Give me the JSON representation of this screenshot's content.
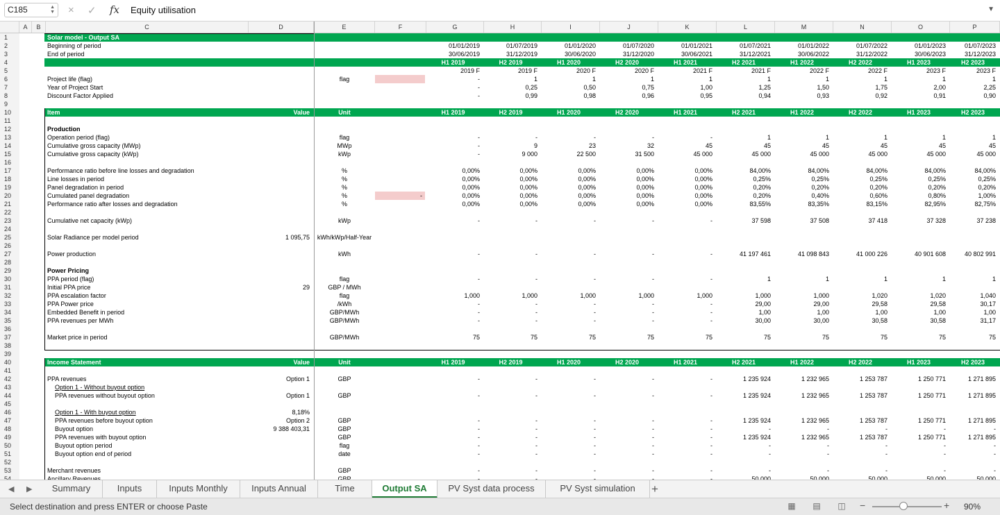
{
  "formula_bar": {
    "name_box": "C185",
    "cancel_icon": "×",
    "enter_icon": "✓",
    "fx_label": "fx",
    "formula": "Equity utilisation"
  },
  "columns": [
    "A",
    "B",
    "C",
    "D",
    "E",
    "F",
    "G",
    "H",
    "I",
    "J",
    "K",
    "L",
    "M",
    "N",
    "O",
    "P"
  ],
  "rows": [
    {
      "n": "1",
      "cls": "hdr",
      "cells": {
        "C": "Solar model - Output SA"
      }
    },
    {
      "n": "2",
      "cells": {
        "C": "Beginning of period",
        "G": "01/01/2019",
        "H": "01/07/2019",
        "I": "01/01/2020",
        "J": "01/07/2020",
        "K": "01/01/2021",
        "L": "01/07/2021",
        "M": "01/01/2022",
        "N": "01/07/2022",
        "O": "01/01/2023",
        "P": "01/07/2023"
      }
    },
    {
      "n": "3",
      "cells": {
        "C": "End of period",
        "G": "30/06/2019",
        "H": "31/12/2019",
        "I": "30/06/2020",
        "J": "31/12/2020",
        "K": "30/06/2021",
        "L": "31/12/2021",
        "M": "30/06/2022",
        "N": "31/12/2022",
        "O": "30/06/2023",
        "P": "31/12/2023"
      }
    },
    {
      "n": "4",
      "cls": "hdr",
      "cells": {
        "G": "H1 2019",
        "H": "H2 2019",
        "I": "H1 2020",
        "J": "H2 2020",
        "K": "H1 2021",
        "L": "H2 2021",
        "M": "H1 2022",
        "N": "H2 2022",
        "O": "H1 2023",
        "P": "H2 2023"
      }
    },
    {
      "n": "5",
      "cells": {
        "G": "2019 F",
        "H": "2019 F",
        "I": "2020 F",
        "J": "2020 F",
        "K": "2021 F",
        "L": "2021 F",
        "M": "2022 F",
        "N": "2022 F",
        "O": "2023 F",
        "P": "2023 F"
      }
    },
    {
      "n": "6",
      "pink": true,
      "cells": {
        "C": "Project life (flag)",
        "E": "flag",
        "G": "-",
        "H": "1",
        "I": "1",
        "J": "1",
        "K": "1",
        "L": "1",
        "M": "1",
        "N": "1",
        "O": "1",
        "P": "1"
      }
    },
    {
      "n": "7",
      "cells": {
        "C": "Year of Project Start",
        "G": "-",
        "H": "0,25",
        "I": "0,50",
        "J": "0,75",
        "K": "1,00",
        "L": "1,25",
        "M": "1,50",
        "N": "1,75",
        "O": "2,00",
        "P": "2,25"
      }
    },
    {
      "n": "8",
      "cells": {
        "C": "Discount Factor Applied",
        "G": "-",
        "H": "0,99",
        "I": "0,98",
        "J": "0,96",
        "K": "0,95",
        "L": "0,94",
        "M": "0,93",
        "N": "0,92",
        "O": "0,91",
        "P": "0,90"
      }
    },
    {
      "n": "9",
      "cells": {}
    },
    {
      "n": "10",
      "cls": "hdr",
      "cells": {
        "C": "Item",
        "D": "Value",
        "E": "Unit",
        "G": "H1 2019",
        "H": "H2 2019",
        "I": "H1 2020",
        "J": "H2 2020",
        "K": "H1 2021",
        "L": "H2 2021",
        "M": "H1 2022",
        "N": "H2 2022",
        "O": "H1 2023",
        "P": "H2 2023"
      }
    },
    {
      "n": "11",
      "cells": {}
    },
    {
      "n": "12",
      "bold": true,
      "cells": {
        "C": "Production"
      }
    },
    {
      "n": "13",
      "cells": {
        "C": "Operation period (flag)",
        "E": "flag",
        "G": "-",
        "H": "-",
        "I": "-",
        "J": "-",
        "K": "-",
        "L": "1",
        "M": "1",
        "N": "1",
        "O": "1",
        "P": "1"
      }
    },
    {
      "n": "14",
      "cells": {
        "C": "Cumulative gross capacity (MWp)",
        "E": "MWp",
        "G": "-",
        "H": "9",
        "I": "23",
        "J": "32",
        "K": "45",
        "L": "45",
        "M": "45",
        "N": "45",
        "O": "45",
        "P": "45"
      }
    },
    {
      "n": "15",
      "cells": {
        "C": "Cumulative gross capacity (kWp)",
        "E": "kWp",
        "G": "-",
        "H": "9 000",
        "I": "22 500",
        "J": "31 500",
        "K": "45 000",
        "L": "45 000",
        "M": "45 000",
        "N": "45 000",
        "O": "45 000",
        "P": "45 000"
      }
    },
    {
      "n": "16",
      "cells": {}
    },
    {
      "n": "17",
      "cells": {
        "C": "Performance ratio before line losses and degradation",
        "E": "%",
        "G": "0,00%",
        "H": "0,00%",
        "I": "0,00%",
        "J": "0,00%",
        "K": "0,00%",
        "L": "84,00%",
        "M": "84,00%",
        "N": "84,00%",
        "O": "84,00%",
        "P": "84,00%"
      }
    },
    {
      "n": "18",
      "cells": {
        "C": "Line losses in period",
        "E": "%",
        "G": "0,00%",
        "H": "0,00%",
        "I": "0,00%",
        "J": "0,00%",
        "K": "0,00%",
        "L": "0,25%",
        "M": "0,25%",
        "N": "0,25%",
        "O": "0,25%",
        "P": "0,25%"
      }
    },
    {
      "n": "19",
      "cells": {
        "C": "Panel degradation in period",
        "E": "%",
        "G": "0,00%",
        "H": "0,00%",
        "I": "0,00%",
        "J": "0,00%",
        "K": "0,00%",
        "L": "0,20%",
        "M": "0,20%",
        "N": "0,20%",
        "O": "0,20%",
        "P": "0,20%"
      }
    },
    {
      "n": "20",
      "pink": true,
      "cells": {
        "C": "Cumulated panel degradation",
        "E": "%",
        "F": "-",
        "G": "0,00%",
        "H": "0,00%",
        "I": "0,00%",
        "J": "0,00%",
        "K": "0,00%",
        "L": "0,20%",
        "M": "0,40%",
        "N": "0,60%",
        "O": "0,80%",
        "P": "1,00%"
      }
    },
    {
      "n": "21",
      "cells": {
        "C": "Performance ratio after losses and degradation",
        "E": "%",
        "G": "0,00%",
        "H": "0,00%",
        "I": "0,00%",
        "J": "0,00%",
        "K": "0,00%",
        "L": "83,55%",
        "M": "83,35%",
        "N": "83,15%",
        "O": "82,95%",
        "P": "82,75%"
      }
    },
    {
      "n": "22",
      "cells": {}
    },
    {
      "n": "23",
      "cells": {
        "C": "Cumulative net capacity (kWp)",
        "E": "kWp",
        "G": "-",
        "H": "-",
        "I": "-",
        "J": "-",
        "K": "-",
        "L": "37 598",
        "M": "37 508",
        "N": "37 418",
        "O": "37 328",
        "P": "37 238"
      }
    },
    {
      "n": "24",
      "cells": {}
    },
    {
      "n": "25",
      "cells": {
        "C": "Solar Radiance per model period",
        "D": "1 095,75",
        "E": "kWh/kWp/Half-Year"
      }
    },
    {
      "n": "26",
      "cells": {}
    },
    {
      "n": "27",
      "cells": {
        "C": "Power production",
        "E": "kWh",
        "G": "-",
        "H": "-",
        "I": "-",
        "J": "-",
        "K": "-",
        "L": "41 197 461",
        "M": "41 098 843",
        "N": "41 000 226",
        "O": "40 901 608",
        "P": "40 802 991"
      }
    },
    {
      "n": "28",
      "cells": {}
    },
    {
      "n": "29",
      "bold": true,
      "cells": {
        "C": "Power Pricing"
      }
    },
    {
      "n": "30",
      "cells": {
        "C": "PPA period (flag)",
        "E": "flag",
        "G": "-",
        "H": "-",
        "I": "-",
        "J": "-",
        "K": "-",
        "L": "1",
        "M": "1",
        "N": "1",
        "O": "1",
        "P": "1"
      }
    },
    {
      "n": "31",
      "cells": {
        "C": "Initial PPA price",
        "D": "29",
        "E": "GBP / MWh"
      }
    },
    {
      "n": "32",
      "cells": {
        "C": "PPA escalation factor",
        "E": "flag",
        "G": "1,000",
        "H": "1,000",
        "I": "1,000",
        "J": "1,000",
        "K": "1,000",
        "L": "1,000",
        "M": "1,000",
        "N": "1,020",
        "O": "1,020",
        "P": "1,040"
      }
    },
    {
      "n": "33",
      "cells": {
        "C": "PPA Power price",
        "E": "/kWh",
        "G": "-",
        "H": "-",
        "I": "-",
        "J": "-",
        "K": "-",
        "L": "29,00",
        "M": "29,00",
        "N": "29,58",
        "O": "29,58",
        "P": "30,17"
      }
    },
    {
      "n": "34",
      "cells": {
        "C": "Embedded Benefit in period",
        "E": "GBP/MWh",
        "G": "-",
        "H": "-",
        "I": "-",
        "J": "-",
        "K": "-",
        "L": "1,00",
        "M": "1,00",
        "N": "1,00",
        "O": "1,00",
        "P": "1,00"
      }
    },
    {
      "n": "35",
      "cells": {
        "C": "PPA revenues per MWh",
        "E": "GBP/MWh",
        "G": "-",
        "H": "-",
        "I": "-",
        "J": "-",
        "K": "-",
        "L": "30,00",
        "M": "30,00",
        "N": "30,58",
        "O": "30,58",
        "P": "31,17"
      }
    },
    {
      "n": "36",
      "cells": {}
    },
    {
      "n": "37",
      "cells": {
        "C": "Market price in period",
        "E": "GBP/MWh",
        "G": "75",
        "H": "75",
        "I": "75",
        "J": "75",
        "K": "75",
        "L": "75",
        "M": "75",
        "N": "75",
        "O": "75",
        "P": "75"
      }
    },
    {
      "n": "38",
      "cells": {}
    },
    {
      "n": "39",
      "cells": {}
    },
    {
      "n": "40",
      "cls": "hdr",
      "cells": {
        "C": "Income Statement",
        "D": "Value",
        "E": "Unit",
        "G": "H1 2019",
        "H": "H2 2019",
        "I": "H1 2020",
        "J": "H2 2020",
        "K": "H1 2021",
        "L": "H2 2021",
        "M": "H1 2022",
        "N": "H2 2022",
        "O": "H1 2023",
        "P": "H2 2023"
      }
    },
    {
      "n": "41",
      "cells": {}
    },
    {
      "n": "42",
      "cells": {
        "C": "PPA revenues",
        "D": "Option 1",
        "E": "GBP",
        "G": "-",
        "H": "-",
        "I": "-",
        "J": "-",
        "K": "-",
        "L": "1 235 924",
        "M": "1 232 965",
        "N": "1 253 787",
        "O": "1 250 771",
        "P": "1 271 895"
      }
    },
    {
      "n": "43",
      "indent": true,
      "ul": true,
      "cells": {
        "C": "Option 1 - Without buyout option"
      }
    },
    {
      "n": "44",
      "indent": true,
      "cells": {
        "C": "PPA revenues without buyout option",
        "D": "Option 1",
        "E": "GBP",
        "G": "-",
        "H": "-",
        "I": "-",
        "J": "-",
        "K": "-",
        "L": "1 235 924",
        "M": "1 232 965",
        "N": "1 253 787",
        "O": "1 250 771",
        "P": "1 271 895"
      }
    },
    {
      "n": "45",
      "cells": {}
    },
    {
      "n": "46",
      "indent": true,
      "ul": true,
      "cells": {
        "C": "Option 1 - With buyout option",
        "D": "8,18%"
      }
    },
    {
      "n": "47",
      "indent": true,
      "cells": {
        "C": "PPA revenues before buyout option",
        "D": "Option 2",
        "E": "GBP",
        "G": "-",
        "H": "-",
        "I": "-",
        "J": "-",
        "K": "-",
        "L": "1 235 924",
        "M": "1 232 965",
        "N": "1 253 787",
        "O": "1 250 771",
        "P": "1 271 895"
      }
    },
    {
      "n": "48",
      "indent": true,
      "cells": {
        "C": "Buyout option",
        "D": "9 388 403,31",
        "E": "GBP",
        "G": "-",
        "H": "-",
        "I": "-",
        "J": "-",
        "K": "-",
        "L": "-",
        "M": "-",
        "N": "-",
        "O": "-",
        "P": "-"
      }
    },
    {
      "n": "49",
      "indent": true,
      "cells": {
        "C": "PPA revenues with buyout option",
        "E": "GBP",
        "G": "-",
        "H": "-",
        "I": "-",
        "J": "-",
        "K": "-",
        "L": "1 235 924",
        "M": "1 232 965",
        "N": "1 253 787",
        "O": "1 250 771",
        "P": "1 271 895"
      }
    },
    {
      "n": "50",
      "indent": true,
      "cells": {
        "C": "Buyout option period",
        "E": "flag",
        "G": "-",
        "H": "-",
        "I": "-",
        "J": "-",
        "K": "-",
        "L": "-",
        "M": "-",
        "N": "-",
        "O": "-",
        "P": "-"
      }
    },
    {
      "n": "51",
      "indent": true,
      "cells": {
        "C": "Buyout option end of period",
        "E": "date",
        "G": "-",
        "H": "-",
        "I": "-",
        "J": "-",
        "K": "-",
        "L": "-",
        "M": "-",
        "N": "-",
        "O": "-",
        "P": "-"
      }
    },
    {
      "n": "52",
      "cells": {}
    },
    {
      "n": "53",
      "cells": {
        "C": "Merchant revenues",
        "E": "GBP",
        "G": "-",
        "H": "-",
        "I": "-",
        "J": "-",
        "K": "-",
        "L": "-",
        "M": "-",
        "N": "-",
        "O": "-",
        "P": "-"
      }
    },
    {
      "n": "54",
      "cells": {
        "C": "Ancillary Revenues",
        "E": "GBP",
        "G": "-",
        "H": "-",
        "I": "-",
        "J": "-",
        "K": "-",
        "L": "50 000",
        "M": "50 000",
        "N": "50 000",
        "O": "50 000",
        "P": "50 000"
      }
    }
  ],
  "tabs": {
    "nav_prev": "◀",
    "nav_next": "▶",
    "items": [
      "Summary",
      "Inputs",
      "Inputs Monthly",
      "Inputs Annual",
      "Time",
      "Output SA",
      "PV Syst data process",
      "PV Syst simulation"
    ],
    "active": "Output SA",
    "add_label": "+"
  },
  "status": {
    "text": "Select destination and press ENTER or choose Paste",
    "zoom": "90%",
    "zoom_level": 0.45
  },
  "icons": {
    "cancel": "close-icon",
    "enter": "check-icon",
    "expand": "chevron-down-icon",
    "view_normal": "grid-view-icon",
    "view_page_layout": "page-layout-icon",
    "view_page_break": "page-break-icon"
  },
  "colors": {
    "header_green": "#00a650",
    "active_tab": "#1e7b34",
    "input_pink": "#f4cccc"
  }
}
